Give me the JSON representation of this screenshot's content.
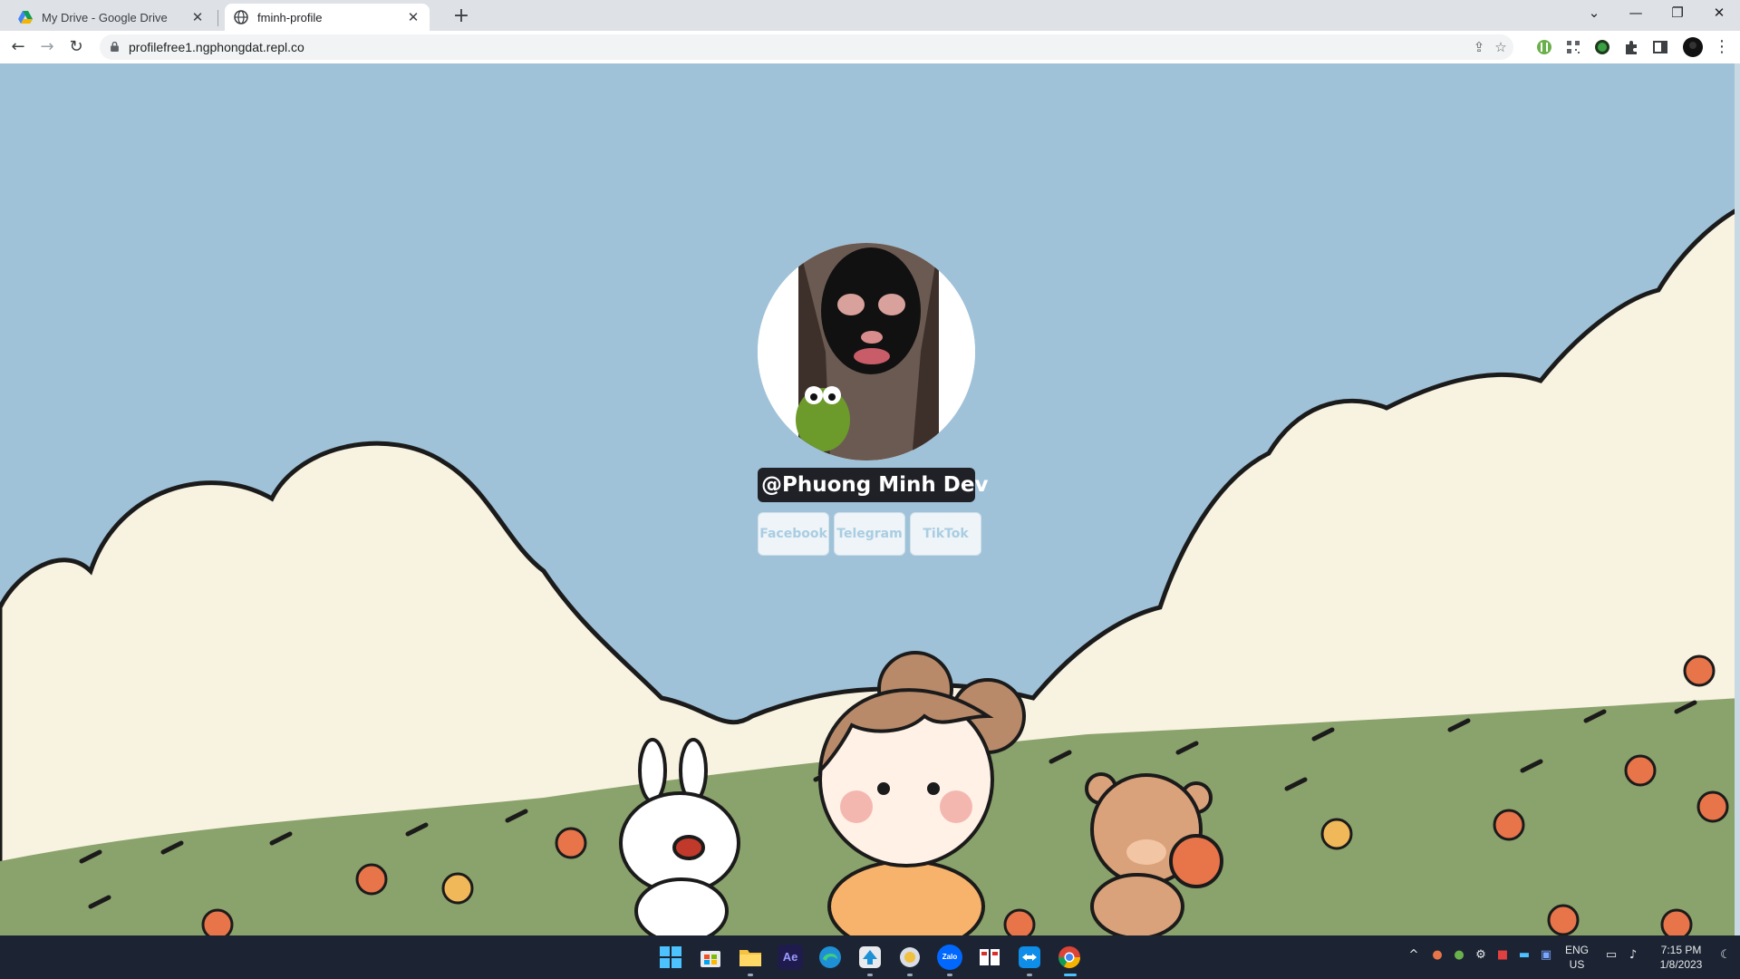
{
  "browser": {
    "tabs": [
      {
        "title": "My Drive - Google Drive",
        "active": false,
        "icon": "google-drive-icon"
      },
      {
        "title": "fminh-profile",
        "active": true,
        "icon": "globe-icon"
      }
    ],
    "new_tab_label": "+",
    "url": "profilefree1.ngphongdat.repl.co"
  },
  "profile": {
    "username": "@Phuong Minh Dev",
    "links": [
      "Facebook",
      "Telegram",
      "TikTok"
    ]
  },
  "taskbar": {
    "apps": [
      "windows-start-icon",
      "microsoft-store-icon",
      "file-explorer-icon",
      "after-effects-icon",
      "edge-icon",
      "app-icon",
      "app-icon",
      "zalo-icon",
      "app-icon",
      "teamviewer-icon",
      "chrome-icon"
    ],
    "after_effects_label": "Ae",
    "zalo_label": "Zalo",
    "language": "ENG",
    "region": "US",
    "time": "7:15 PM",
    "date": "1/8/2023"
  },
  "colors": {
    "sky": "#9fc2d9",
    "cloud": "#f8f2e0",
    "grass": "#8aa26b",
    "username_bg": "#1f2126",
    "link_text": "#a9cde2"
  }
}
